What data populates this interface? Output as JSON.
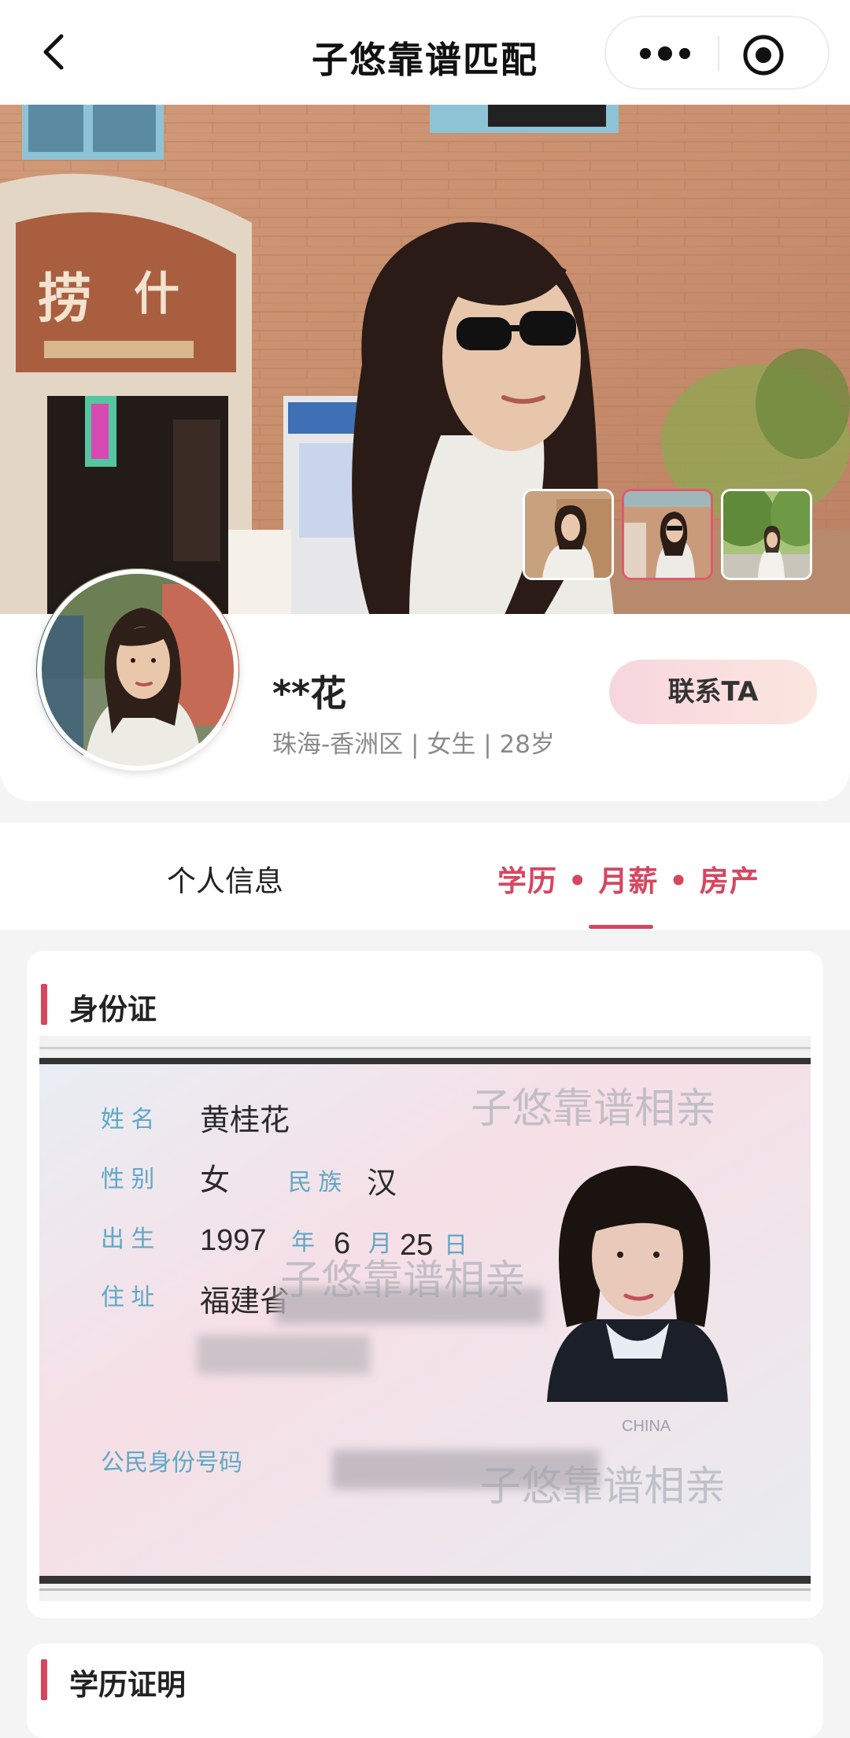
{
  "navbar": {
    "title": "子悠靠谱匹配",
    "back_icon": "chevron-left-icon",
    "more_icon": "more-dots-icon",
    "close_icon": "target-close-icon"
  },
  "hero": {
    "photo_label": "profile-photo",
    "sign_char_1": "捞",
    "sign_char_2": "什",
    "thumb_count": 3,
    "active_thumb": 2
  },
  "profile": {
    "name": "**花",
    "meta": "珠海-香洲区 | 女生 | 28岁",
    "contact_label": "联系TA"
  },
  "tabs": [
    {
      "label": "个人信息",
      "active": false
    },
    {
      "label": "学历 • 月薪 • 房产",
      "active": true
    }
  ],
  "id_card": {
    "section_title": "身份证",
    "name_label": "姓 名",
    "name_value": "黄桂花",
    "sex_label": "性 别",
    "sex_value": "女",
    "ethnic_label": "民 族",
    "ethnic_value": "汉",
    "birth_label": "出 生",
    "birth_year": "1997",
    "year_unit": "年",
    "birth_month": "6",
    "month_unit": "月",
    "birth_day": "25",
    "day_unit": "日",
    "address_label": "住 址",
    "address_value": "福建省",
    "id_number_label": "公民身份号码",
    "watermark": "子悠靠谱相亲",
    "photo_caption": "CHINA"
  },
  "education": {
    "section_title": "学历证明"
  },
  "colors": {
    "accent": "#d6465f",
    "contact_bg_start": "#f8d6df",
    "contact_bg_end": "#fbe6df",
    "page_bg": "#f4f4f4"
  }
}
